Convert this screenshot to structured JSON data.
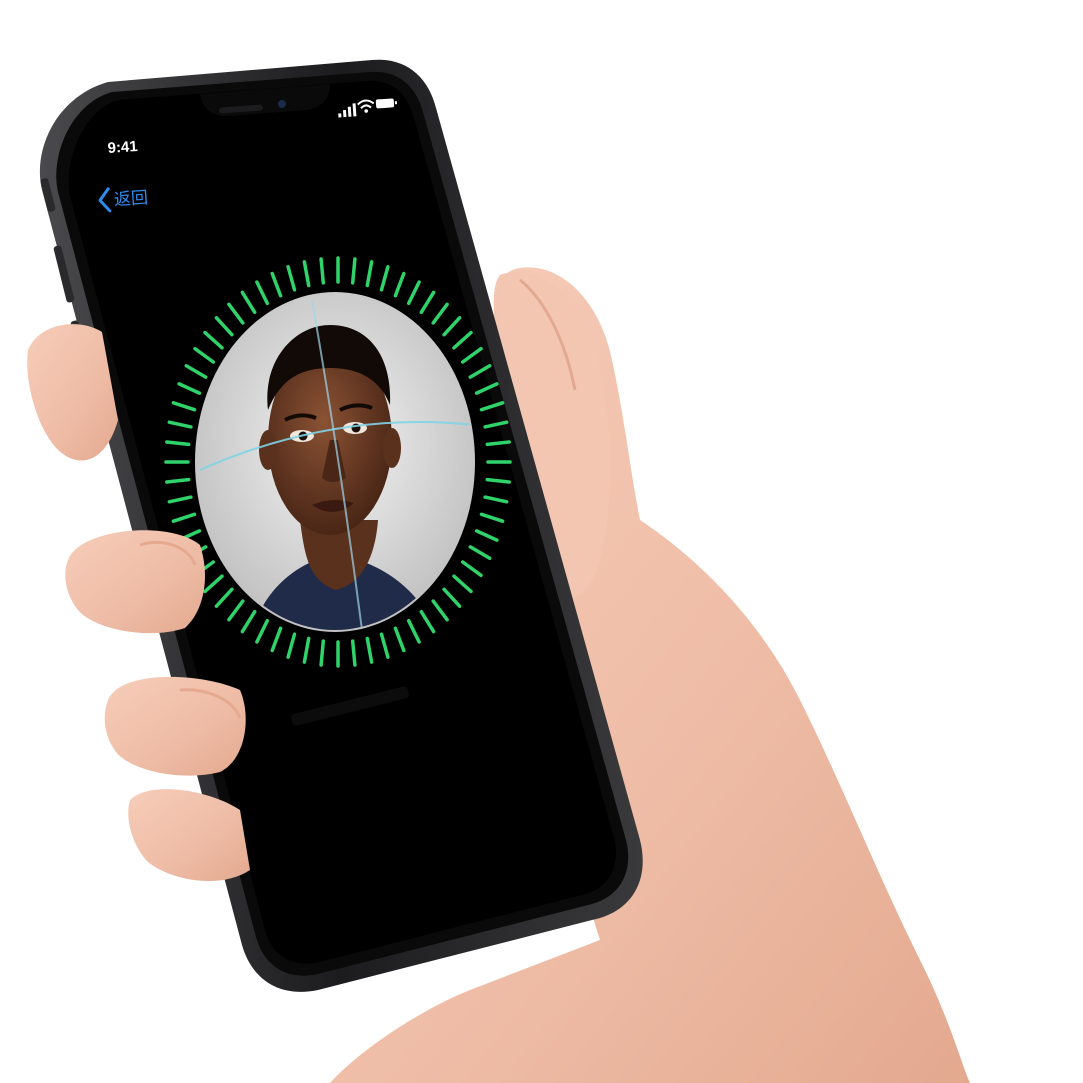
{
  "status_bar": {
    "time": "9:41",
    "signal_icon": "cellular-signal-icon",
    "wifi_icon": "wifi-icon",
    "battery_icon": "battery-icon"
  },
  "navigation": {
    "back_label": "返回",
    "back_icon": "chevron-left-icon"
  },
  "face_id": {
    "progress_ring_icon": "face-scan-progress-ring",
    "ring_color": "#2fd36a",
    "scan_line_color": "#7fd3e6"
  },
  "colors": {
    "screen": "#000000",
    "back_link": "#2d8cf0",
    "frame": "#2a2a2c",
    "skin": "#f1c2ad"
  }
}
